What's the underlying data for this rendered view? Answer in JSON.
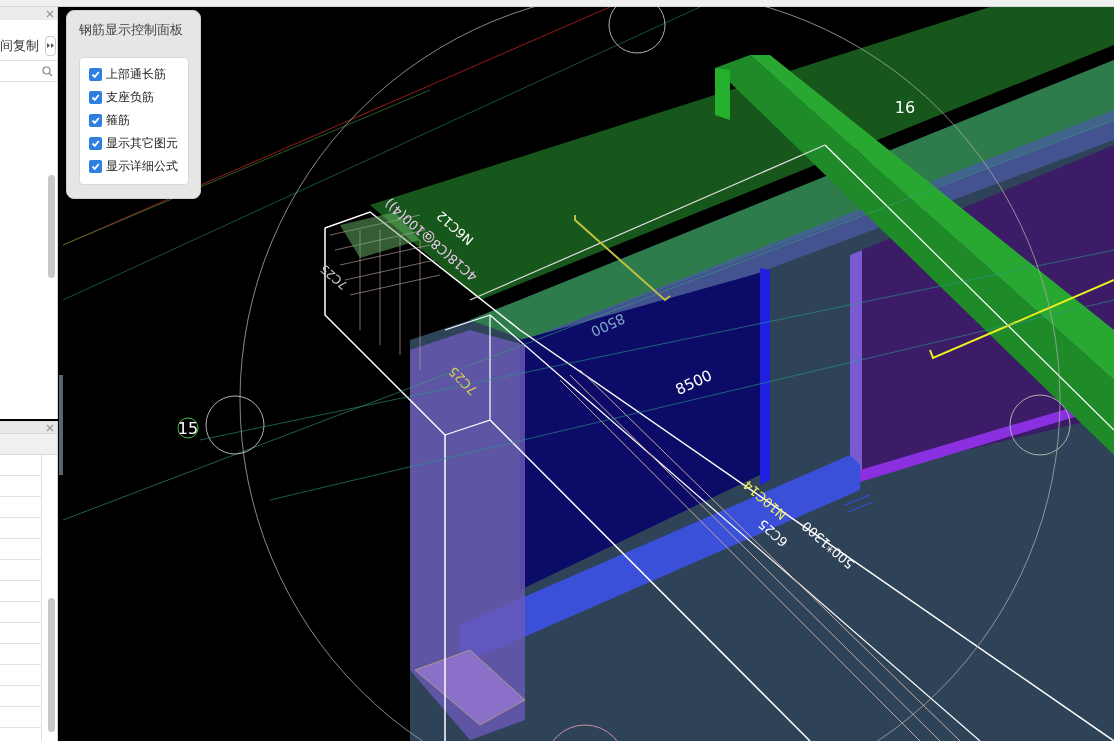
{
  "left_panel": {
    "toolbar_text": "间复制"
  },
  "control_panel": {
    "title": "钢筋显示控制面板",
    "items": [
      {
        "label": "上部通长筋",
        "checked": true
      },
      {
        "label": "支座负筋",
        "checked": true
      },
      {
        "label": "箍筋",
        "checked": true
      },
      {
        "label": "显示其它图元",
        "checked": true
      },
      {
        "label": "显示详细公式",
        "checked": true
      }
    ]
  },
  "canvas_labels": [
    {
      "text": "16",
      "color": "#ffffff"
    },
    {
      "text": "15",
      "color": "#ffffff"
    },
    {
      "text": "8500",
      "color": "#ffffff"
    },
    {
      "text": "8500",
      "color": "#7fa8c8"
    },
    {
      "text": "4C18(C8@100(4))",
      "color": "#f0c8f0"
    },
    {
      "text": "N6C12",
      "color": "#ffffff"
    },
    {
      "text": "7C25",
      "color": "#c8c8d0"
    },
    {
      "text": "7C25",
      "color": "#d8c860"
    },
    {
      "text": "N10C14",
      "color": "#f0f060"
    },
    {
      "text": "6C25",
      "color": "#ffffff"
    },
    {
      "text": "500*1300",
      "color": "#ffffff"
    }
  ]
}
